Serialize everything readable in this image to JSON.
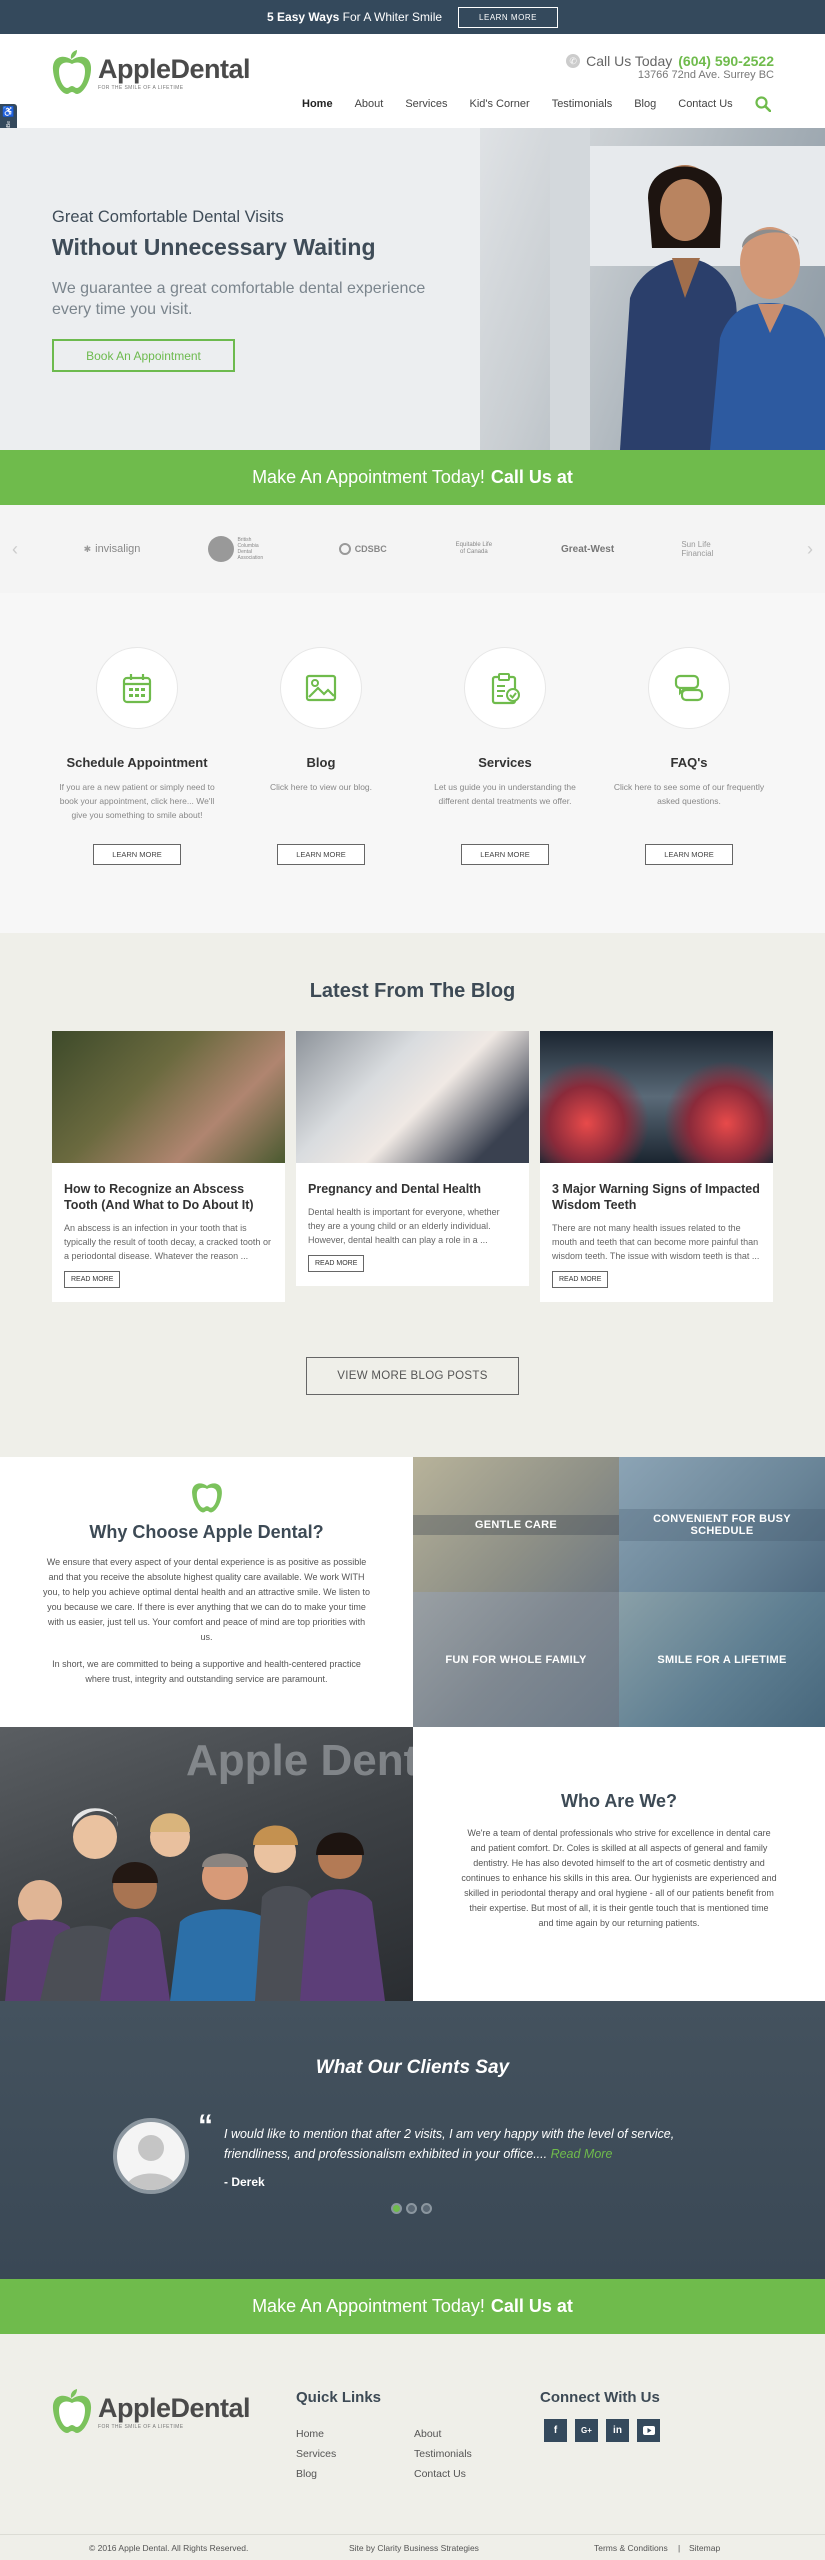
{
  "topbar": {
    "promo_bold": "5 Easy Ways",
    "promo_rest": "For A Whiter Smile",
    "button": "LEARN MORE"
  },
  "header": {
    "logo_text": "AppleDental",
    "logo_tagline": "FOR THE SMILE OF A LIFETIME",
    "call_label": "Call Us Today",
    "phone": "(604) 590-2522",
    "address": "13766 72nd Ave. Surrey BC",
    "nav": [
      "Home",
      "About",
      "Services",
      "Kid's Corner",
      "Testimonials",
      "Blog",
      "Contact Us"
    ]
  },
  "side_tab": "accessiBe",
  "hero": {
    "line1": "Great Comfortable Dental Visits",
    "line2": "Without Unnecessary Waiting",
    "sub": "We guarantee a great comfortable dental experience every time you visit.",
    "button": "Book An Appointment"
  },
  "callbar": {
    "text": "Make An Appointment Today!",
    "bold": "Call Us at"
  },
  "partners": [
    "invisalign",
    "British Columbia Dental Association",
    "CDSBC",
    "Equitable Life of Canada",
    "Great-West",
    "Sun Life Financial"
  ],
  "services": [
    {
      "title": "Schedule Appointment",
      "desc": "If you are a new patient or simply need to book your appointment, click here... We'll give you something to smile about!",
      "button": "LEARN MORE",
      "icon": "calendar-icon"
    },
    {
      "title": "Blog",
      "desc": "Click here to view our blog.",
      "button": "LEARN MORE",
      "icon": "image-icon"
    },
    {
      "title": "Services",
      "desc": "Let us guide you in understanding the different dental treatments we offer.",
      "button": "LEARN MORE",
      "icon": "clipboard-icon"
    },
    {
      "title": "FAQ's",
      "desc": "Click here to see some of our frequently asked questions.",
      "button": "LEARN MORE",
      "icon": "chat-icon"
    }
  ],
  "blog": {
    "title": "Latest From The Blog",
    "posts": [
      {
        "title": "How to Recognize an Abscess Tooth (And What to Do About It)",
        "excerpt": "An abscess is an infection in your tooth that is typically the result of tooth decay, a cracked tooth or a periodontal disease. Whatever the reason ...",
        "button": "READ MORE"
      },
      {
        "title": "Pregnancy and Dental Health",
        "excerpt": "Dental health is important for everyone, whether they are a young child or an elderly individual. However, dental health can play a role in a ...",
        "button": "READ MORE"
      },
      {
        "title": "3 Major Warning Signs of Impacted Wisdom Teeth",
        "excerpt": "There are not many health issues related to the mouth and teeth that can become more painful than wisdom teeth. The issue with wisdom teeth is that ...",
        "button": "READ MORE"
      }
    ],
    "more_button": "VIEW MORE BLOG POSTS"
  },
  "why": {
    "title": "Why Choose Apple Dental?",
    "p1": "We ensure that every aspect of your dental experience is as positive as possible and that you receive the absolute highest quality care available. We work WITH you, to help you achieve optimal dental health and an attractive smile. We listen to you because we care. If there is ever anything that we can do to make your time with us easier, just tell us. Your comfort and peace of mind are top priorities with us.",
    "p2": "In short, we are committed to being a supportive and health-centered practice where trust, integrity and outstanding service are paramount.",
    "tiles": [
      "GENTLE CARE",
      "CONVENIENT FOR BUSY SCHEDULE",
      "FUN FOR WHOLE FAMILY",
      "SMILE FOR A LIFETIME"
    ]
  },
  "who": {
    "photo_sign": "Apple Dental",
    "title": "Who Are We?",
    "text": "We're a team of dental professionals who strive for excellence in dental care and patient comfort. Dr. Coles is skilled at all aspects of general and family dentistry. He has also devoted himself to the art of cosmetic dentistry and continues to enhance his skills in this area. Our hygienists are experienced and skilled in periodontal therapy and oral hygiene - all of our patients benefit from their expertise. But most of all, it is their gentle touch that is mentioned time and time again by our returning patients."
  },
  "testimonials": {
    "title": "What Our Clients Say",
    "quote": "I would like to mention that after 2 visits, I am very happy with the level of service, friendliness, and professionalism exhibited in your office....",
    "read_more": "Read More",
    "author": "- Derek",
    "slide_count": 3,
    "active_slide": 1
  },
  "footer": {
    "quick_links_title": "Quick Links",
    "links_col1": [
      "Home",
      "Services",
      "Blog"
    ],
    "links_col2": [
      "About",
      "Testimonials",
      "Contact Us"
    ],
    "connect_title": "Connect With Us",
    "social": [
      "f",
      "G+",
      "in",
      "yt"
    ],
    "copyright": "© 2016 Apple Dental. All Rights Reserved.",
    "credit": "Site by Clarity Business Strategies",
    "terms": "Terms & Conditions",
    "sep": "|",
    "sitemap": "Sitemap"
  },
  "colors": {
    "brand_green": "#6fbb4c",
    "navy": "#34495c",
    "heading": "#3d4a55"
  }
}
